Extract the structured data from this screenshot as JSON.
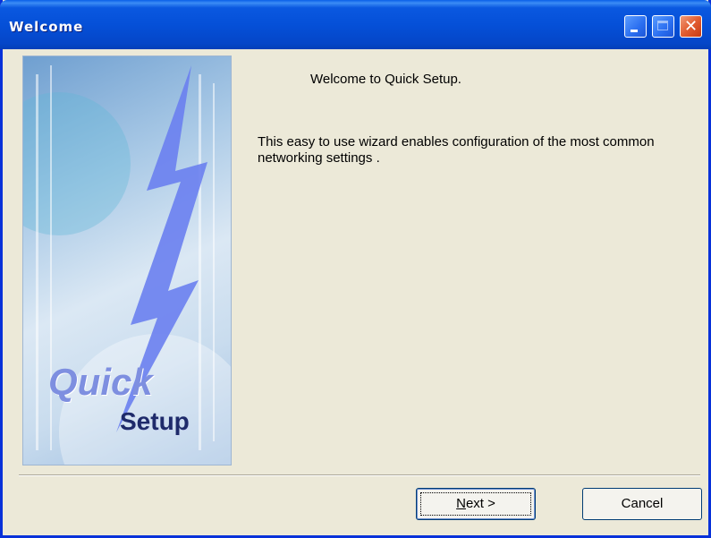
{
  "window": {
    "title": "Welcome"
  },
  "titlebar_buttons": {
    "minimize_icon": "minimize-icon",
    "maximize_icon": "maximize-icon",
    "close_icon": "close-icon"
  },
  "banner": {
    "line1": "Quick",
    "line2": "Setup"
  },
  "content": {
    "heading": "Welcome to Quick Setup.",
    "description": "This easy to use wizard enables configuration of the most common networking settings ."
  },
  "buttons": {
    "next_mnemonic": "N",
    "next_rest": "ext >",
    "cancel": "Cancel"
  },
  "colors": {
    "titlebar": "#0550d8",
    "close_button": "#e25d30",
    "dialog_bg": "#ece9d8"
  }
}
